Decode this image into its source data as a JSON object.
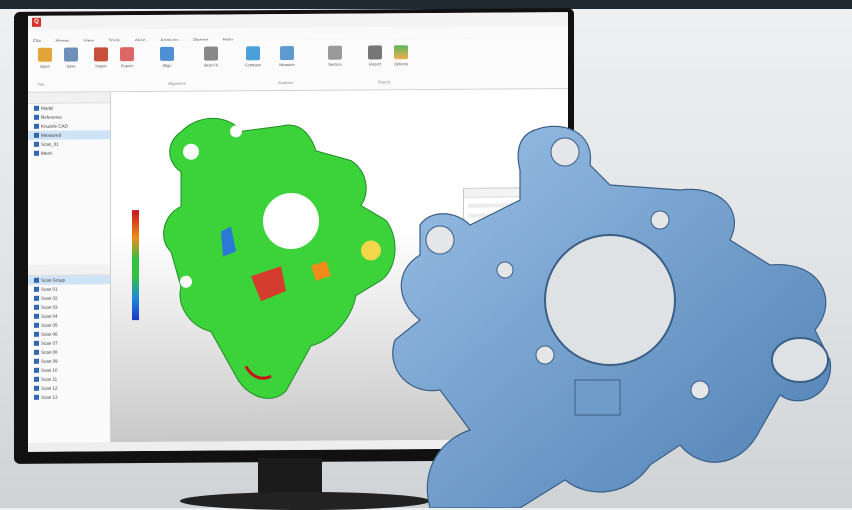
{
  "app": {
    "logo_text": "Q",
    "window_title": "",
    "tabs": [
      "File",
      "Home",
      "View",
      "Tools",
      "Align",
      "Analysis",
      "Report",
      "Help"
    ]
  },
  "ribbon": {
    "buttons": [
      "Open",
      "Save",
      "Import",
      "Export",
      "Align",
      "Best Fit",
      "Compare",
      "Measure",
      "Section",
      "Report",
      "Options"
    ],
    "groups": [
      "File",
      "Alignment",
      "Analysis",
      "Report"
    ]
  },
  "tree_top": {
    "items": [
      "Model",
      "Reference",
      "Knuckle CAD",
      "Measured",
      "Scan_01",
      "Mesh"
    ]
  },
  "tree_bottom": {
    "items": [
      "Scan Group",
      "Scan 01",
      "Scan 02",
      "Scan 03",
      "Scan 04",
      "Scan 05",
      "Scan 06",
      "Scan 07",
      "Scan 08",
      "Scan 09",
      "Scan 10",
      "Scan 11",
      "Scan 12",
      "Scan 13"
    ]
  },
  "legend": {
    "colors": [
      "#c9111b",
      "#ef8c1a",
      "#32c242",
      "#1e8ad9",
      "#1a36c9"
    ]
  },
  "dialog": {
    "title": "",
    "button": ""
  },
  "colors": {
    "deviation_green": "#3bd23a",
    "cad_blue": "#6f9cc8",
    "monitor_bezel": "#111111"
  }
}
